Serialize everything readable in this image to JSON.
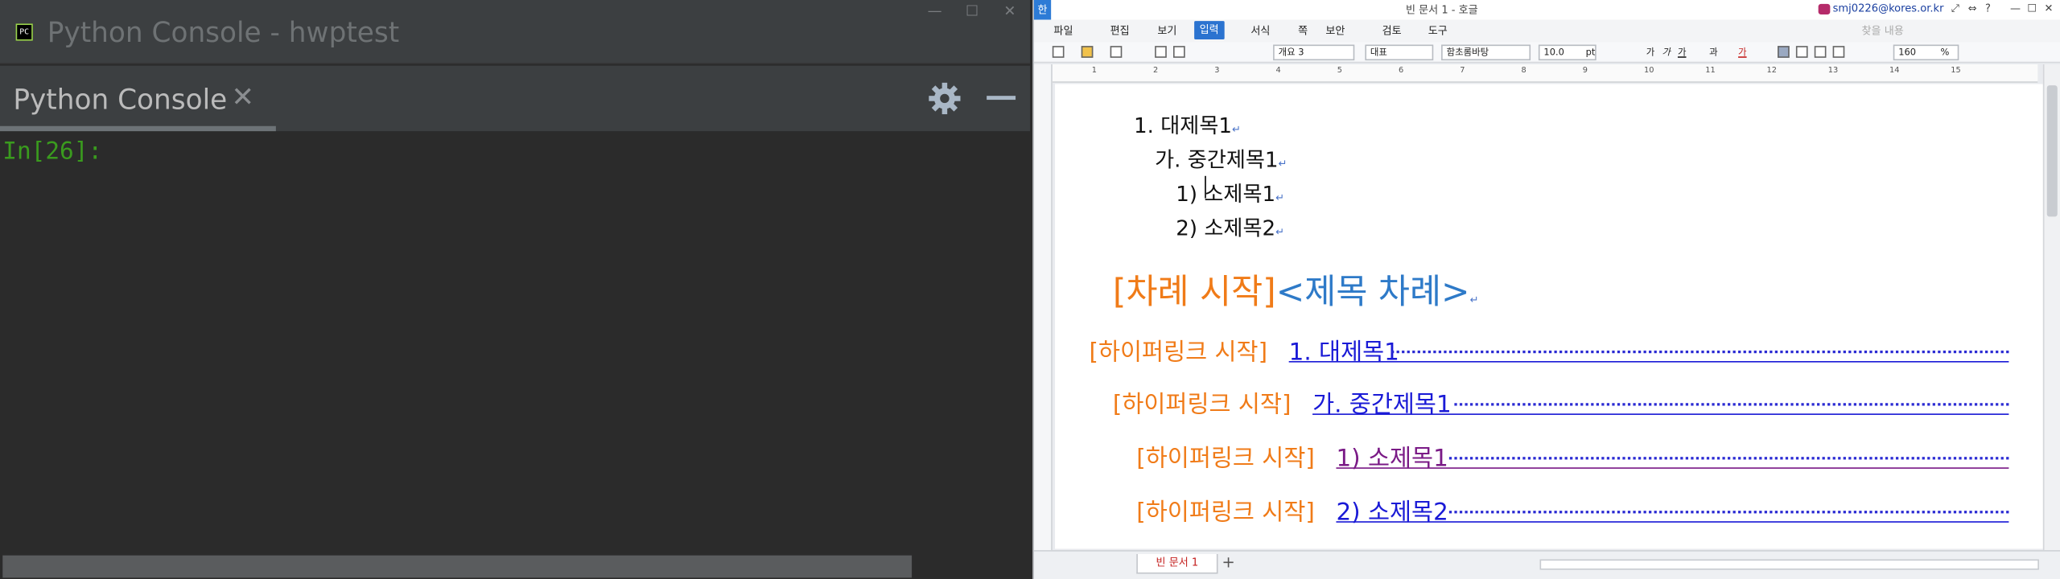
{
  "python_console": {
    "window_title": "Python Console - hwptest",
    "window_controls": [
      "—",
      "☐",
      "✕"
    ],
    "tab_label": "Python Console",
    "tab_close": "✕",
    "prompt": "In[26]:"
  },
  "hwp": {
    "app_icon": "한",
    "title": "빈 문서 1 - 호글",
    "user": "smj0226@kores.or.kr",
    "title_buttons": [
      "⤢",
      "⇔",
      "?",
      "—",
      "☐",
      "✕"
    ],
    "menu": {
      "items": [
        "파일",
        "편집",
        "보기",
        "입력",
        "서식",
        "쪽",
        "보안",
        "검토",
        "도구"
      ],
      "active": "입력",
      "search_placeholder": "찾을 내용"
    },
    "toolbar": {
      "style": "개요 3",
      "para_shape": "대표",
      "font": "함초롬바탕",
      "size": "10.0",
      "size_unit": "pt",
      "zoom": "160",
      "zoom_unit": "%",
      "format_buttons": [
        "가",
        "가",
        "가",
        "과",
        "가"
      ]
    },
    "ruler_numbers": [
      "1",
      "2",
      "3",
      "4",
      "5",
      "6",
      "7",
      "8",
      "9",
      "10",
      "11",
      "12",
      "13",
      "14",
      "15"
    ],
    "document": {
      "heading1": "1.  대제목1",
      "heading2": "가.  중간제목1",
      "heading3a_num": "1) ",
      "heading3a_text": "소제목1",
      "heading3b": "2)  소제목2",
      "para_mark": "↵",
      "toc_start_tag": "[차례  시작]",
      "toc_field": "<제목  차례>",
      "hyperlink_tag": "[하이퍼링크  시작]",
      "toc_entries": [
        {
          "text": "1.  대제목1",
          "color": "#1a1ad6"
        },
        {
          "text": "가.  중간제목1",
          "color": "#1a1ad6"
        },
        {
          "text": "1)  소제목1",
          "color": "#7a1a86"
        },
        {
          "text": "2)  소제목2",
          "color": "#1a1ad6"
        }
      ]
    },
    "status": {
      "doc_tab": "빈 문서 1",
      "add_tab": "+"
    }
  }
}
